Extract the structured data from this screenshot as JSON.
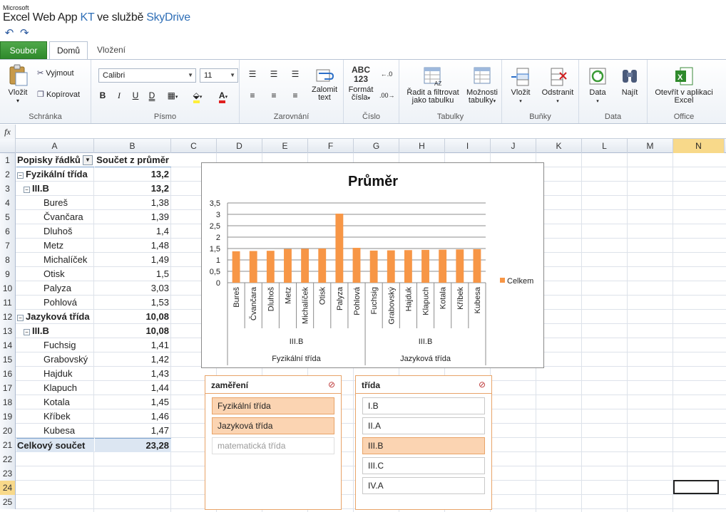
{
  "app": {
    "brand_small": "Microsoft",
    "brand_main": "Excel Web App",
    "title_mid": " KT ",
    "title_service": "ve službě ",
    "title_skydrive": "SkyDrive"
  },
  "qat": {
    "undo_icon": "undo-icon",
    "redo_icon": "redo-icon"
  },
  "tabs": {
    "file": "Soubor",
    "home": "Domů",
    "insert": "Vložení"
  },
  "ribbon": {
    "clipboard": {
      "label": "Schránka",
      "paste": "Vložit",
      "cut": "Vyjmout",
      "copy": "Kopírovat"
    },
    "font": {
      "label": "Písmo",
      "name": "Calibri",
      "size": "11",
      "bold": "B",
      "italic": "I",
      "underline": "U",
      "double_underline": "D"
    },
    "alignment": {
      "label": "Zarovnání",
      "wrap_line1": "Zalomit",
      "wrap_line2": "text"
    },
    "number": {
      "label": "Číslo",
      "format_line1": "Formát",
      "format_line2": "čísla",
      "abc": "ABC",
      "num": "123"
    },
    "tables": {
      "label": "Tabulky",
      "sort_line1": "Řadit a filtrovat",
      "sort_line2": "jako tabulku",
      "options_line1": "Možnosti",
      "options_line2": "tabulky"
    },
    "cells": {
      "label": "Buňky",
      "insert": "Vložit",
      "delete": "Odstranit"
    },
    "data": {
      "label": "Data",
      "data": "Data",
      "find": "Najít"
    },
    "office": {
      "label": "Office",
      "open_line1": "Otevřít v aplikaci",
      "open_line2": "Excel"
    }
  },
  "formula_bar": {
    "fx": "fx",
    "value": ""
  },
  "columns": [
    "A",
    "B",
    "C",
    "D",
    "E",
    "F",
    "G",
    "H",
    "I",
    "J",
    "K",
    "L",
    "M",
    "N"
  ],
  "rows_numbers": [
    "1",
    "2",
    "3",
    "4",
    "5",
    "6",
    "7",
    "8",
    "9",
    "10",
    "11",
    "12",
    "13",
    "14",
    "15",
    "16",
    "17",
    "18",
    "19",
    "20",
    "21",
    "22",
    "23",
    "24",
    "25"
  ],
  "pivot": {
    "header_rows": "Popisky řádků",
    "header_values": "Součet z průměr",
    "rows": [
      {
        "label": "Fyzikální třída",
        "value": "13,2",
        "level": 0,
        "bold": true,
        "toggle": "⊟"
      },
      {
        "label": "III.B",
        "value": "13,2",
        "level": 1,
        "bold": true,
        "toggle": "⊟"
      },
      {
        "label": "Bureš",
        "value": "1,38",
        "level": 2,
        "bold": false
      },
      {
        "label": "Čvančara",
        "value": "1,39",
        "level": 2,
        "bold": false
      },
      {
        "label": "Dluhoš",
        "value": "1,4",
        "level": 2,
        "bold": false
      },
      {
        "label": "Metz",
        "value": "1,48",
        "level": 2,
        "bold": false
      },
      {
        "label": "Michalíček",
        "value": "1,49",
        "level": 2,
        "bold": false
      },
      {
        "label": "Otisk",
        "value": "1,5",
        "level": 2,
        "bold": false
      },
      {
        "label": "Palyza",
        "value": "3,03",
        "level": 2,
        "bold": false
      },
      {
        "label": "Pohlová",
        "value": "1,53",
        "level": 2,
        "bold": false
      },
      {
        "label": "Jazyková třída",
        "value": "10,08",
        "level": 0,
        "bold": true,
        "toggle": "⊟"
      },
      {
        "label": "III.B",
        "value": "10,08",
        "level": 1,
        "bold": true,
        "toggle": "⊟"
      },
      {
        "label": "Fuchsig",
        "value": "1,41",
        "level": 2,
        "bold": false
      },
      {
        "label": "Grabovský",
        "value": "1,42",
        "level": 2,
        "bold": false
      },
      {
        "label": "Hajduk",
        "value": "1,43",
        "level": 2,
        "bold": false
      },
      {
        "label": "Klapuch",
        "value": "1,44",
        "level": 2,
        "bold": false
      },
      {
        "label": "Kotala",
        "value": "1,45",
        "level": 2,
        "bold": false
      },
      {
        "label": "Kříbek",
        "value": "1,46",
        "level": 2,
        "bold": false
      },
      {
        "label": "Kubesa",
        "value": "1,47",
        "level": 2,
        "bold": false
      }
    ],
    "total_label": "Celkový součet",
    "total_value": "23,28"
  },
  "chart_data": {
    "type": "bar",
    "title": "Průměr",
    "categories": [
      "Bureš",
      "Čvančara",
      "Dluhoš",
      "Metz",
      "Michalíček",
      "Otisk",
      "Palyza",
      "Pohlová",
      "Fuchsig",
      "Grabovský",
      "Hajduk",
      "Klapuch",
      "Kotala",
      "Kříbek",
      "Kubesa"
    ],
    "series": [
      {
        "name": "Celkem",
        "values": [
          1.38,
          1.39,
          1.4,
          1.48,
          1.49,
          1.5,
          3.03,
          1.53,
          1.41,
          1.42,
          1.43,
          1.44,
          1.45,
          1.46,
          1.47
        ],
        "color": "#f79646"
      }
    ],
    "yticks": [
      "0",
      "0,5",
      "1",
      "1,5",
      "2",
      "2,5",
      "3",
      "3,5"
    ],
    "ylim": [
      0,
      3.5
    ],
    "groups_level1": [
      {
        "label": "III.B",
        "count": 8
      },
      {
        "label": "III.B",
        "count": 7
      }
    ],
    "groups_level2": [
      {
        "label": "Fyzikální třída",
        "count": 8
      },
      {
        "label": "Jazyková třída",
        "count": 7
      }
    ],
    "legend_position": "right",
    "grid": true
  },
  "slicers": [
    {
      "title": "zaměření",
      "clear_icon": "clear-filter-icon",
      "items": [
        {
          "label": "Fyzikální třída",
          "state": "on"
        },
        {
          "label": "Jazyková třída",
          "state": "on"
        },
        {
          "label": "matematická třída",
          "state": "off"
        }
      ]
    },
    {
      "title": "třída",
      "clear_icon": "clear-filter-icon",
      "items": [
        {
          "label": "I.B",
          "state": "normal"
        },
        {
          "label": "II.A",
          "state": "normal"
        },
        {
          "label": "III.B",
          "state": "on"
        },
        {
          "label": "III.C",
          "state": "normal"
        },
        {
          "label": "IV.A",
          "state": "normal"
        }
      ]
    }
  ],
  "colors": {
    "accent": "#2f6fb7",
    "file_tab": "#3a9a35",
    "bar": "#f79646",
    "slicer_selected": "#fbd4b2",
    "active_header": "#f8d98a"
  }
}
